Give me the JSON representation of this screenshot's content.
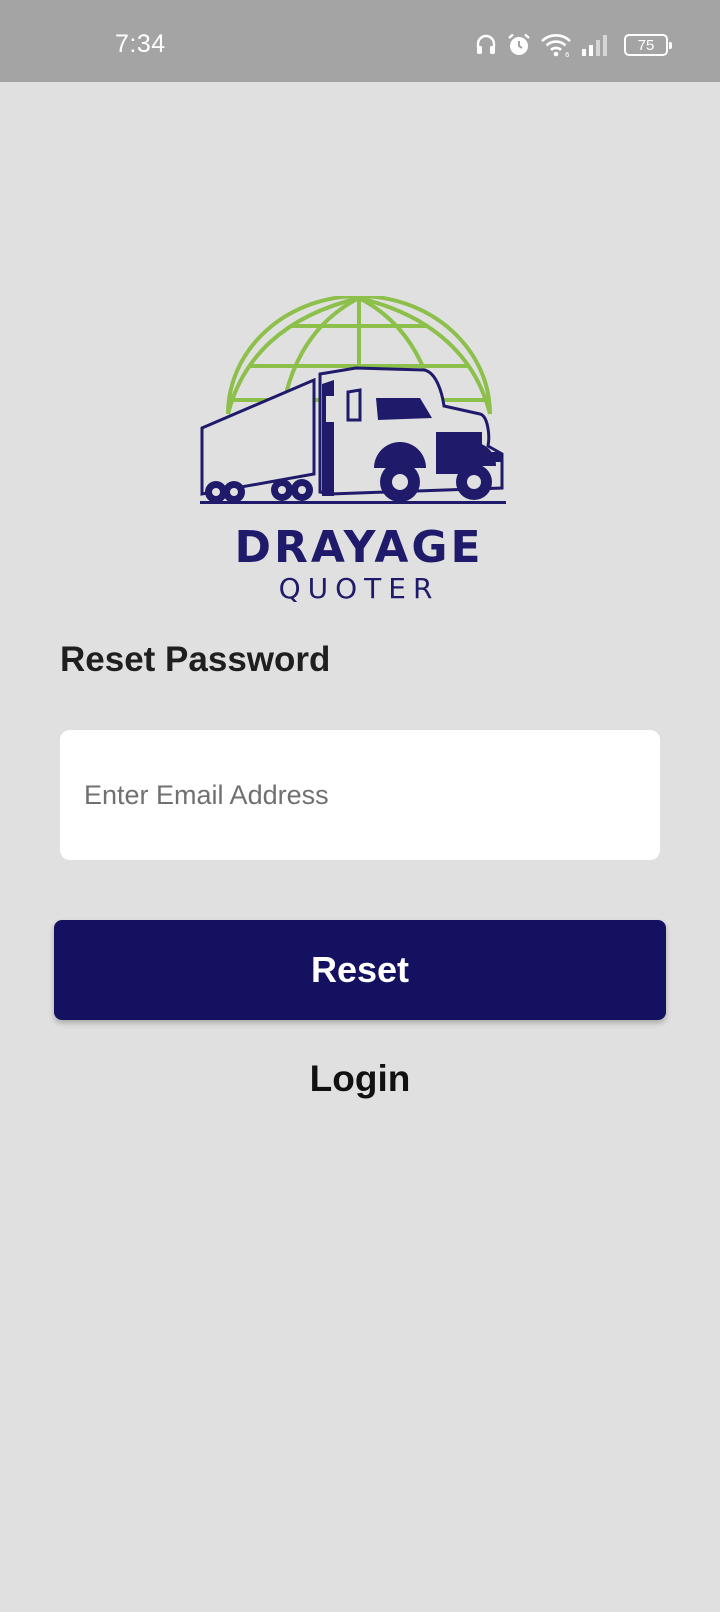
{
  "status_bar": {
    "time": "7:34",
    "battery_level": "75",
    "icons": [
      "headphones-icon",
      "alarm-icon",
      "wifi-icon",
      "signal-icon",
      "battery-icon"
    ]
  },
  "logo": {
    "title": "DRAYAGE",
    "subtitle": "QUOTER",
    "colors": {
      "globe": "#8cc04b",
      "truck": "#1f1b6a"
    }
  },
  "form": {
    "title": "Reset Password",
    "email_placeholder": "Enter Email Address",
    "email_value": "",
    "reset_label": "Reset",
    "login_label": "Login"
  },
  "colors": {
    "background": "#e0e0e0",
    "status_bar": "#a4a4a4",
    "primary_button": "#131160"
  }
}
